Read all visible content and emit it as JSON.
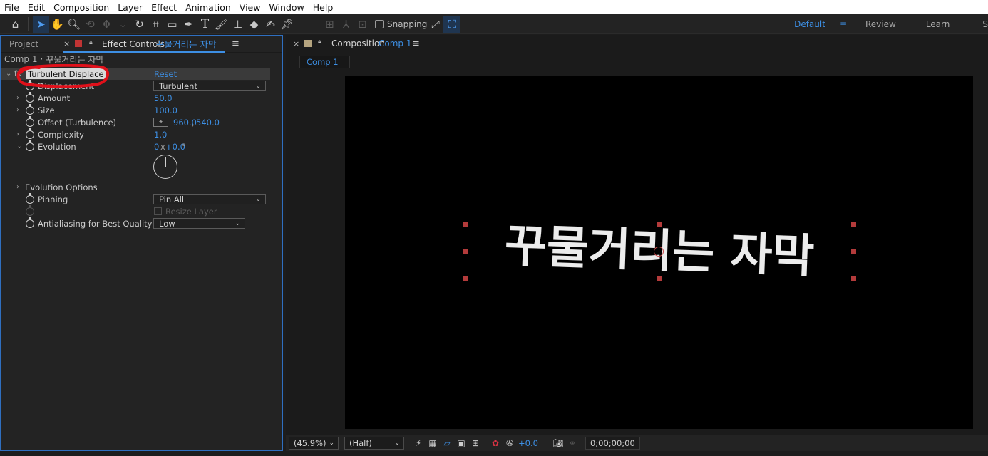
{
  "menubar": {
    "items": [
      "File",
      "Edit",
      "Composition",
      "Layer",
      "Effect",
      "Animation",
      "View",
      "Window",
      "Help"
    ]
  },
  "toolbar": {
    "snapping_label": "Snapping",
    "workspaces": [
      "Default",
      "Review",
      "Learn",
      "S"
    ],
    "active_workspace": "Default",
    "icons": [
      "home-icon",
      "selection-arrow-icon",
      "hand-icon",
      "zoom-icon",
      "orbit-icon",
      "pan-icon",
      "dolly-icon",
      "rotate-icon",
      "pan-behind-icon",
      "rectangle-icon",
      "pen-icon",
      "type-icon",
      "brush-icon",
      "clone-stamp-icon",
      "eraser-icon",
      "roto-brush-icon",
      "puppet-pin-icon"
    ]
  },
  "left_panel": {
    "tab_project": "Project",
    "tab_effect_controls": "Effect Controls",
    "layer_name": "꾸물거리는 자막",
    "breadcrumb_comp": "Comp 1",
    "breadcrumb_sep": "·",
    "breadcrumb_layer": "꾸물거리는 자막",
    "effect": {
      "name": "Turbulent Displace",
      "reset_label": "Reset",
      "displacement_label": "Displacement",
      "displacement_value": "Turbulent",
      "amount_label": "Amount",
      "amount_value": "50.0",
      "size_label": "Size",
      "size_value": "100.0",
      "offset_label": "Offset (Turbulence)",
      "offset_x": "960.0",
      "offset_y": "540.0",
      "complexity_label": "Complexity",
      "complexity_value": "1.0",
      "evolution_label": "Evolution",
      "evolution_revs": "0",
      "evolution_x": "x",
      "evolution_deg": "+0.0",
      "evolution_unit": "°",
      "evolution_options_label": "Evolution Options",
      "pinning_label": "Pinning",
      "pinning_value": "Pin All",
      "resize_layer_label": "Resize Layer",
      "antialiasing_label": "Antialiasing for Best Quality",
      "antialiasing_value": "Low"
    }
  },
  "comp_panel": {
    "tab_prefix": "Composition",
    "comp_name": "Comp 1",
    "sub_tab": "Comp 1",
    "canvas_text": "꾸물거리는 자막",
    "zoom": "(45.9%)",
    "resolution": "(Half)",
    "exposure": "+0.0",
    "timecode": "0;00;00;00"
  },
  "colors": {
    "accent": "#3d8fe4",
    "annotation": "#e0101a",
    "handle": "#b33b3b"
  }
}
